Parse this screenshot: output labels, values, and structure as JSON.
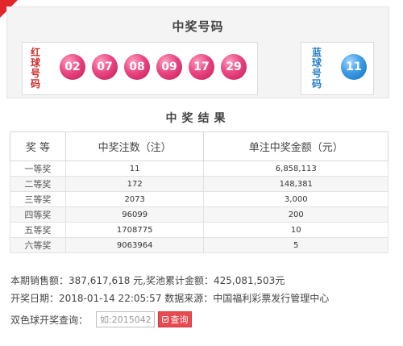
{
  "header": {
    "title": "中奖号码"
  },
  "red": {
    "label": "红球号码",
    "balls": [
      "02",
      "07",
      "08",
      "09",
      "17",
      "29"
    ]
  },
  "blue": {
    "label": "蓝球号码",
    "balls": [
      "11"
    ]
  },
  "results": {
    "title": "中奖结果",
    "headers": [
      "奖 等",
      "中奖注数（注）",
      "单注中奖金额（元）"
    ],
    "rows": [
      [
        "一等奖",
        "11",
        "6,858,113"
      ],
      [
        "二等奖",
        "172",
        "148,381"
      ],
      [
        "三等奖",
        "2073",
        "3,000"
      ],
      [
        "四等奖",
        "96099",
        "200"
      ],
      [
        "五等奖",
        "1708775",
        "10"
      ],
      [
        "六等奖",
        "9063964",
        "5"
      ]
    ]
  },
  "info": {
    "sales": "本期销售额：387,617,618 元,奖池累计金额：425,081,503元",
    "draw": "开奖日期：2018-01-14 22:05:57 数据来源：中国福利彩票发行管理中心"
  },
  "query": {
    "label": "双色球开奖查询：",
    "placeholder": "如:2015042",
    "button": "查询"
  },
  "colors": {
    "accent": "#e3262b",
    "red_ball": "#e2407c",
    "blue_ball": "#3a9ae4"
  }
}
